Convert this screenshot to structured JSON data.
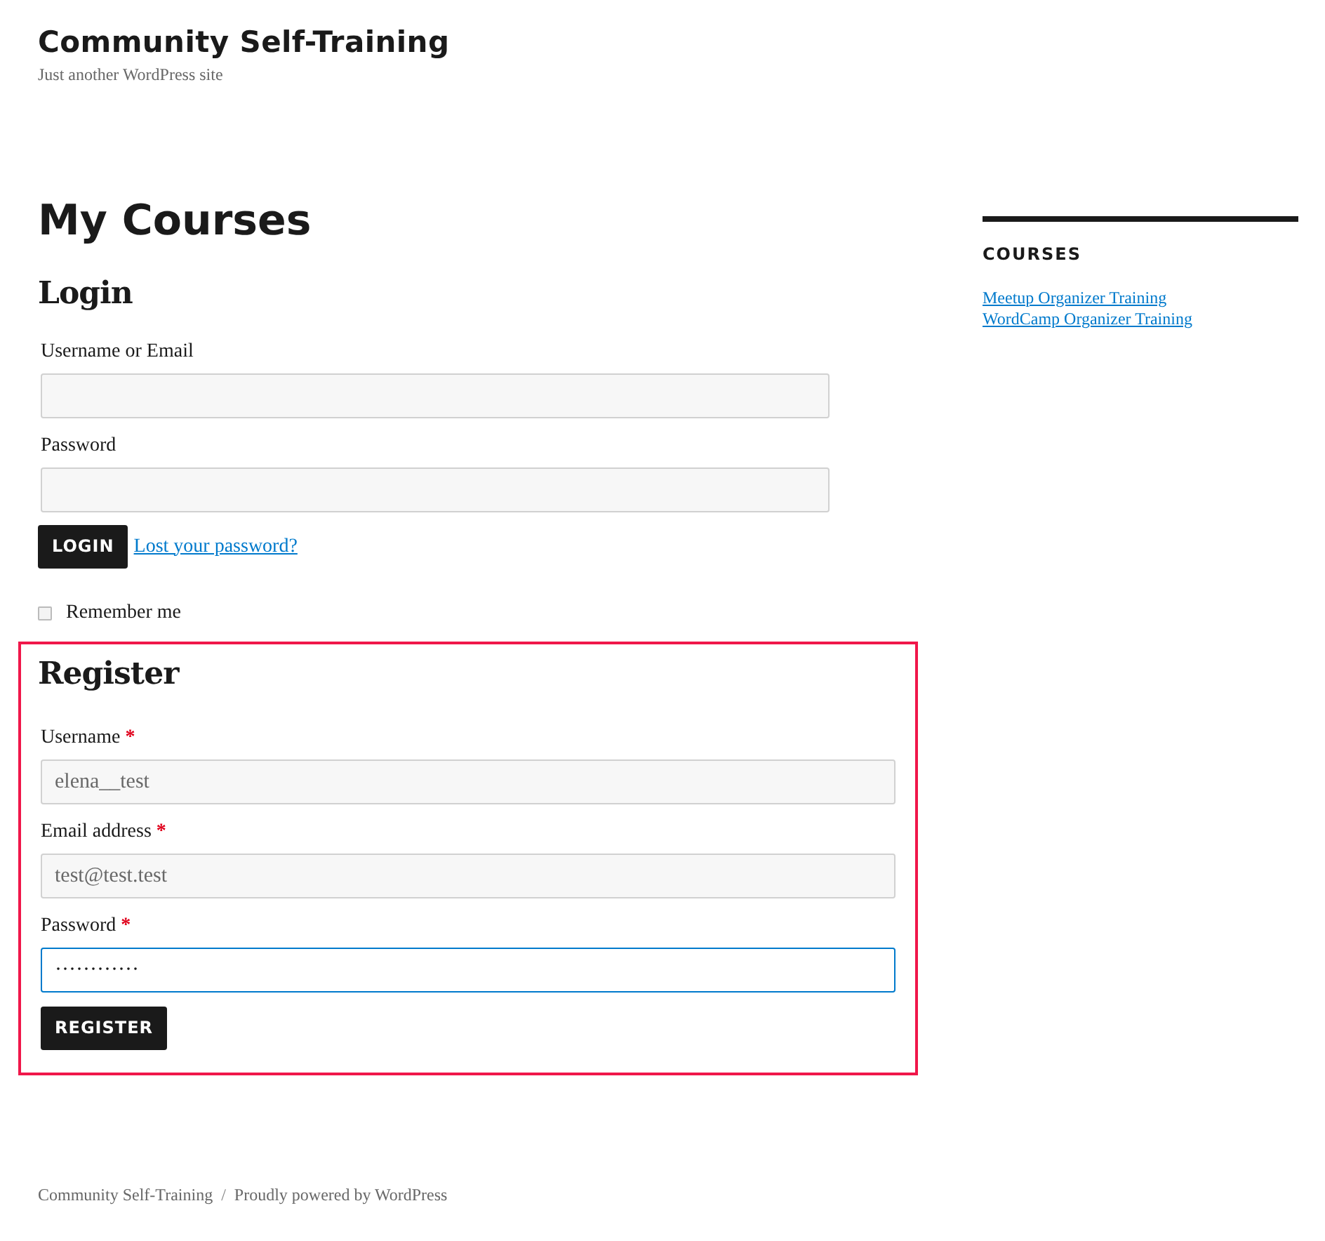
{
  "site": {
    "title": "Community Self-Training",
    "tagline": "Just another WordPress site"
  },
  "page_title": "My Courses",
  "login": {
    "heading": "Login",
    "fields": [
      {
        "label": "Username or Email",
        "focused": false
      },
      {
        "label": "Password",
        "focused": false
      }
    ],
    "button": "LOGIN",
    "lost_password_link": "Lost your password?",
    "remember": {
      "label": "Remember me",
      "checked": false
    }
  },
  "register": {
    "heading": "Register",
    "highlighted": true,
    "fields": [
      {
        "label": "Username",
        "required_mark": "*",
        "value": "elena__test",
        "focused": false
      },
      {
        "label": "Email address",
        "required_mark": "*",
        "value": "test@test.test",
        "focused": false
      },
      {
        "label": "Password",
        "required_mark": "*",
        "value": "············",
        "focused": true
      }
    ],
    "button": "REGISTER"
  },
  "sidebar": {
    "heading": "COURSES",
    "links": [
      "Meetup Organizer Training",
      "WordCamp Organizer Training"
    ]
  },
  "footer": {
    "site_link": "Community Self-Training",
    "separator": "/",
    "powered_link": "Proudly powered by WordPress"
  }
}
